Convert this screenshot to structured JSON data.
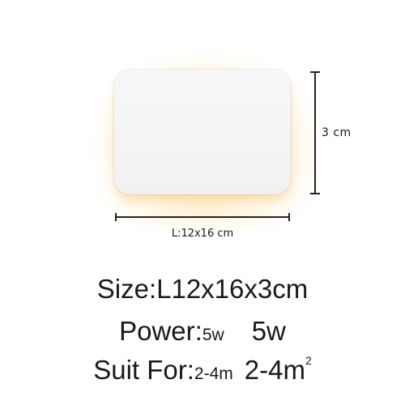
{
  "product": {
    "height_label": "3 cm",
    "length_label": "L:12x16 cm"
  },
  "specs": {
    "size_label": "Size:",
    "size_value": "L12x16x3cm",
    "power_label": "Power:",
    "power_small": "5w",
    "power_value": "5w",
    "suit_label": "Suit For:",
    "suit_small": "2-4m",
    "suit_value": "2-4m",
    "suit_superscript": "2"
  }
}
